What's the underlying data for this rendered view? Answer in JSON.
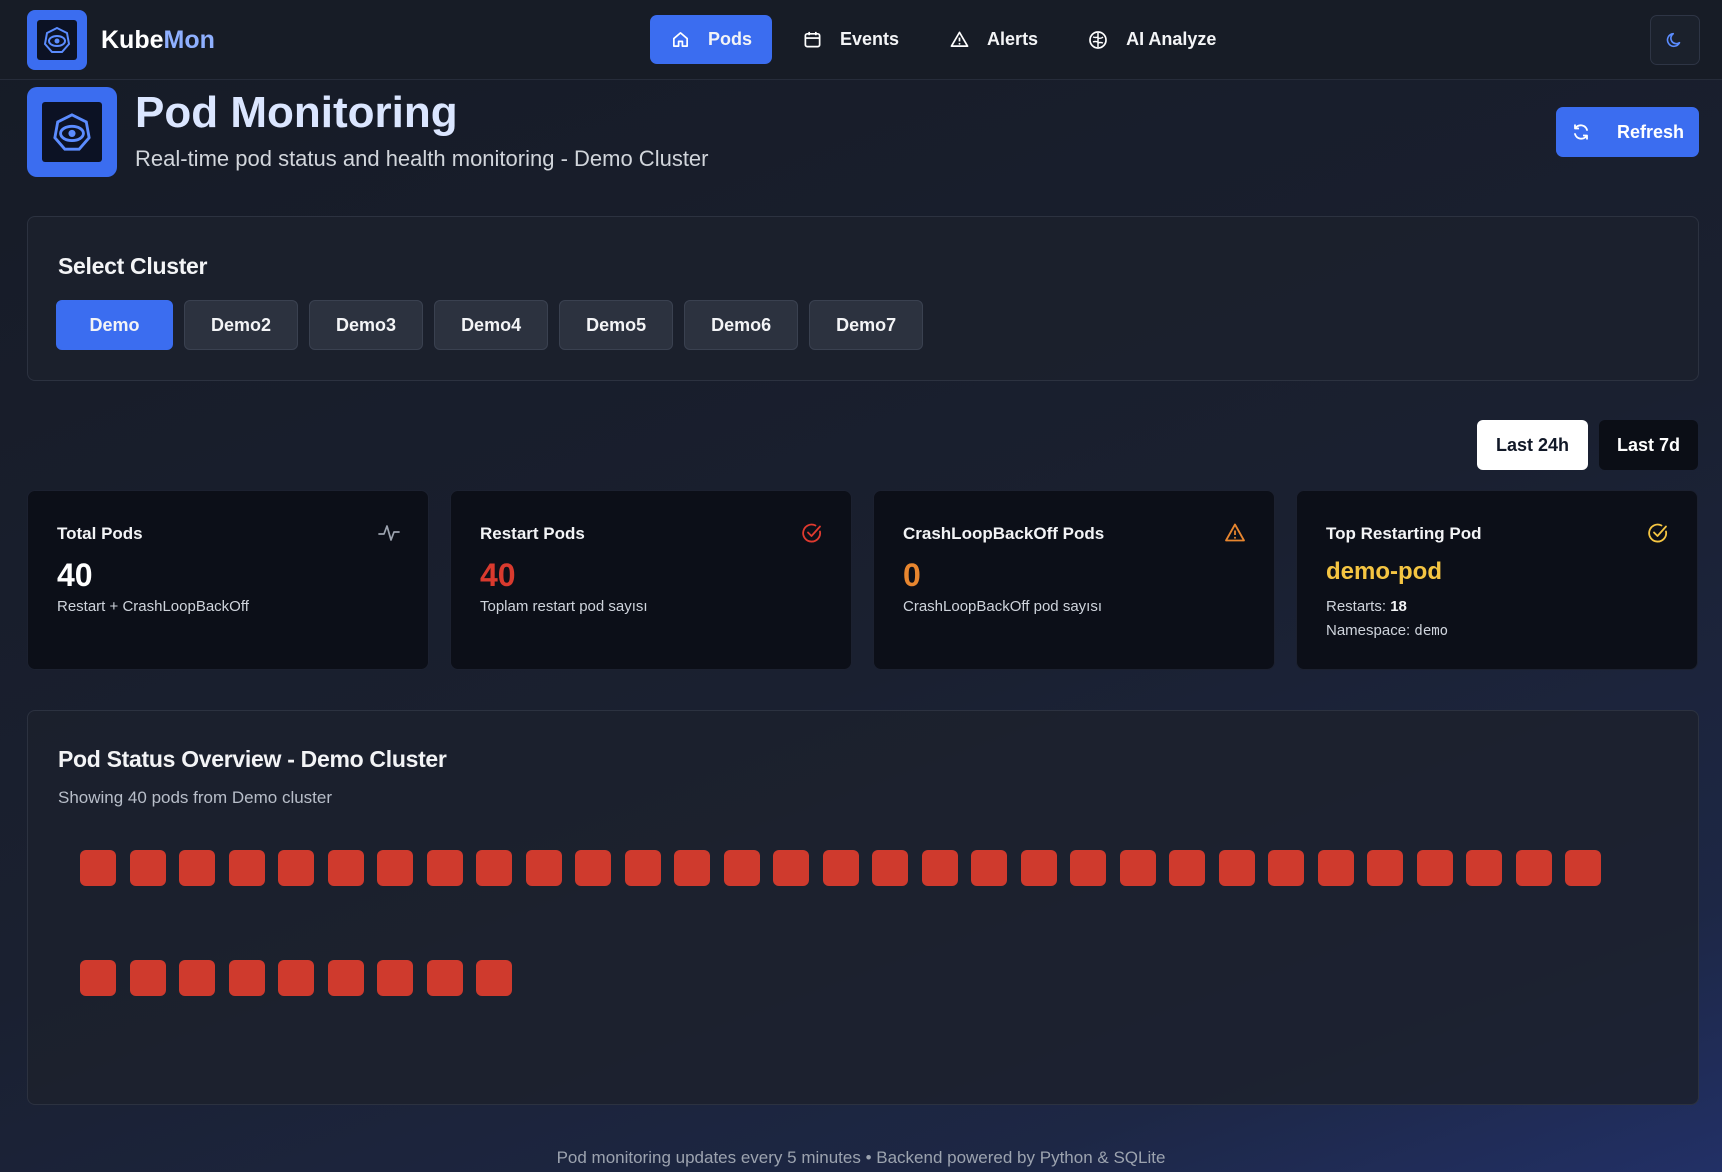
{
  "navbar": {
    "brand_first": "Kube",
    "brand_second": "Mon",
    "items": [
      {
        "label": "Pods",
        "icon": "home-icon",
        "active": true
      },
      {
        "label": "Events",
        "icon": "calendar-icon",
        "active": false
      },
      {
        "label": "Alerts",
        "icon": "warning-icon",
        "active": false
      },
      {
        "label": "AI Analyze",
        "icon": "brain-icon",
        "active": false
      }
    ],
    "theme_icon": "moon-icon"
  },
  "header": {
    "title": "Pod Monitoring",
    "subtitle": "Real-time pod status and health monitoring - Demo Cluster",
    "refresh_label": "Refresh"
  },
  "cluster_select": {
    "title": "Select Cluster",
    "clusters": [
      "Demo",
      "Demo2",
      "Demo3",
      "Demo4",
      "Demo5",
      "Demo6",
      "Demo7"
    ],
    "selected": "Demo"
  },
  "time_range": {
    "options": [
      "Last 24h",
      "Last 7d"
    ]
  },
  "stats": {
    "total": {
      "title": "Total Pods",
      "value": "40",
      "desc": "Restart + CrashLoopBackOff",
      "icon": "activity-icon"
    },
    "restart": {
      "title": "Restart Pods",
      "value": "40",
      "desc": "Toplam restart pod sayısı",
      "icon": "check-circle-icon"
    },
    "crashloop": {
      "title": "CrashLoopBackOff Pods",
      "value": "0",
      "desc": "CrashLoopBackOff pod sayısı",
      "icon": "warning-icon"
    },
    "top": {
      "title": "Top Restarting Pod",
      "pod_name": "demo-pod",
      "restarts_label": "Restarts:",
      "restarts_value": "18",
      "namespace_label": "Namespace:",
      "namespace_value": "demo",
      "icon": "check-circle-icon"
    }
  },
  "colors": {
    "accent": "#3b6df0",
    "danger": "#cf3a2d",
    "warning": "#e8862f",
    "highlight": "#f5c542"
  },
  "status_overview": {
    "title": "Pod Status Overview - Demo Cluster",
    "subtitle": "Showing 40 pods from Demo cluster",
    "pod_count": 40,
    "pod_status": "restart"
  },
  "footer": {
    "text": "Pod monitoring updates every 5 minutes • Backend powered by Python & SQLite"
  }
}
